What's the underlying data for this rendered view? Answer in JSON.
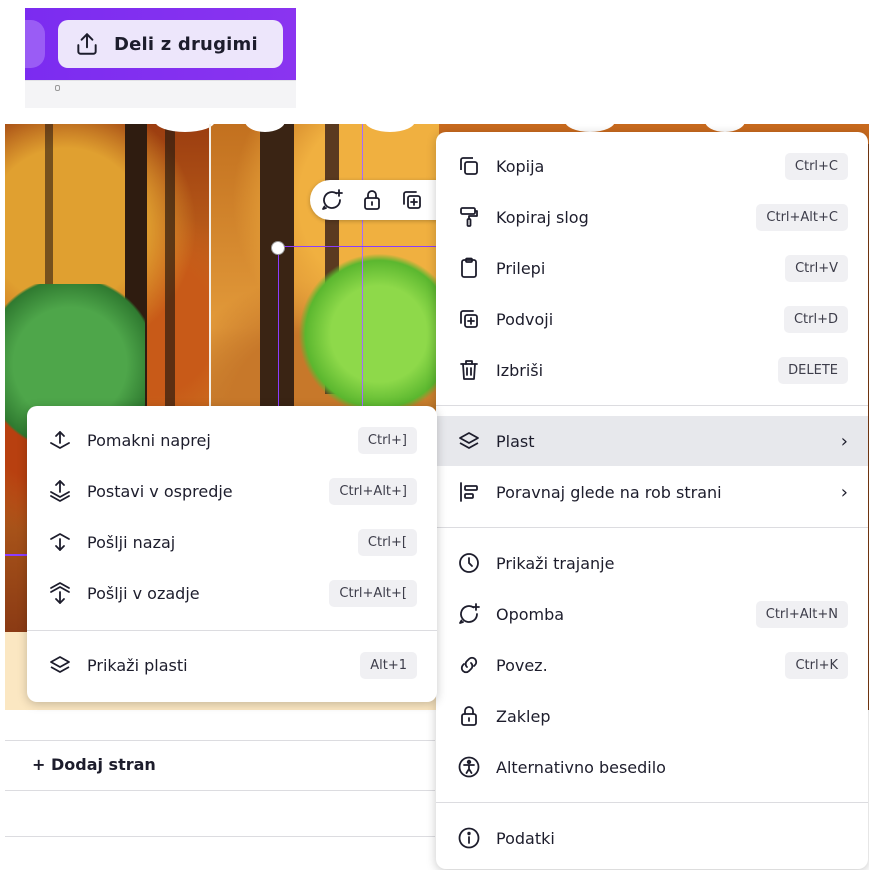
{
  "header": {
    "share_label": "Deli z drugimi"
  },
  "toolbar_icons": [
    "comment-add-icon",
    "lock-icon",
    "duplicate-icon"
  ],
  "canvas": {
    "add_page": "+ Dodaj stran"
  },
  "main_menu": {
    "items": [
      {
        "icon": "copy-icon",
        "label": "Kopija",
        "shortcut": "Ctrl+C"
      },
      {
        "icon": "paint-roller-icon",
        "label": "Kopiraj slog",
        "shortcut": "Ctrl+Alt+C"
      },
      {
        "icon": "clipboard-icon",
        "label": "Prilepi",
        "shortcut": "Ctrl+V"
      },
      {
        "icon": "duplicate-icon",
        "label": "Podvoji",
        "shortcut": "Ctrl+D"
      },
      {
        "icon": "trash-icon",
        "label": "Izbriši",
        "shortcut": "DELETE"
      },
      {
        "icon": "layers-icon",
        "label": "Plast",
        "submenu": true
      },
      {
        "icon": "align-icon",
        "label": "Poravnaj glede na rob strani",
        "submenu": true
      },
      {
        "icon": "clock-icon",
        "label": "Prikaži trajanje"
      },
      {
        "icon": "comment-add-icon",
        "label": "Opomba",
        "shortcut": "Ctrl+Alt+N"
      },
      {
        "icon": "link-icon",
        "label": "Povez.",
        "shortcut": "Ctrl+K"
      },
      {
        "icon": "lock-icon",
        "label": "Zaklep"
      },
      {
        "icon": "accessibility-icon",
        "label": "Alternativno besedilo"
      },
      {
        "icon": "info-icon",
        "label": "Podatki"
      }
    ],
    "chevron": "›"
  },
  "layer_submenu": {
    "items": [
      {
        "icon": "bring-forward-icon",
        "label": "Pomakni naprej",
        "shortcut": "Ctrl+]"
      },
      {
        "icon": "bring-to-front-icon",
        "label": "Postavi v ospredje",
        "shortcut": "Ctrl+Alt+]"
      },
      {
        "icon": "send-backward-icon",
        "label": "Pošlji nazaj",
        "shortcut": "Ctrl+["
      },
      {
        "icon": "send-to-back-icon",
        "label": "Pošlji v ozadje",
        "shortcut": "Ctrl+Alt+["
      },
      {
        "icon": "layers-icon",
        "label": "Prikaži plasti",
        "shortcut": "Alt+1"
      }
    ]
  }
}
